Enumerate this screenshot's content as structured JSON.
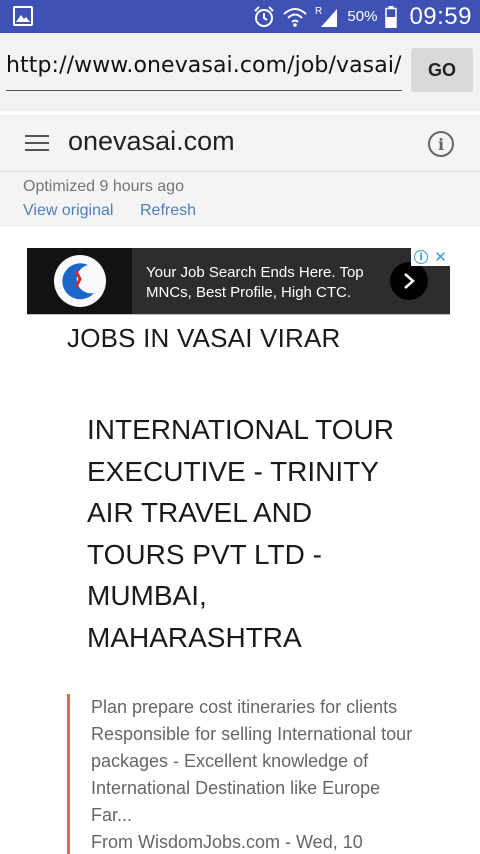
{
  "status_bar": {
    "battery_text": "50%",
    "time": "09:59",
    "icons": [
      "gallery-icon",
      "alarm-icon",
      "wifi-icon",
      "signal-icon",
      "battery-icon"
    ],
    "color": "#3f51b5"
  },
  "url_bar": {
    "value": "http://www.onevasai.com/job/vasai/",
    "go_label": "GO"
  },
  "header": {
    "site_name": "onevasai.com",
    "optimized_text": "Optimized 9 hours ago",
    "view_original_label": "View original",
    "refresh_label": "Refresh",
    "link_color": "#4a7fc1"
  },
  "ad": {
    "text": "Your Job Search Ends Here. Top MNCs, Best Profile, High CTC."
  },
  "content": {
    "heading": "JOBS IN VASAI VIRAR",
    "job_title": "INTERNATIONAL TOUR EXECUTIVE - TRINITY AIR TRAVEL AND TOURS PVT LTD - MUMBAI, MAHARASHTRA",
    "description": "Plan prepare cost itineraries for clients Responsible for selling International tour packages - Excellent knowledge of International Destination like Europe Far...",
    "source_line": "From WisdomJobs.com - Wed, 10",
    "accent_color": "#e96a2d"
  }
}
